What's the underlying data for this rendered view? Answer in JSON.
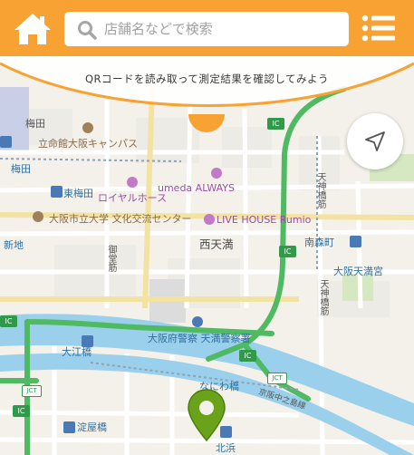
{
  "header": {
    "search": {
      "placeholder": "店舗名などで検索",
      "value": ""
    }
  },
  "banner": {
    "text": "QRコードを読み取って測定結果を確認してみよう"
  },
  "map": {
    "labels": {
      "umeda": "梅田",
      "ritsumeikan": "立命館大阪キャンパス",
      "umeda2": "梅田",
      "higashi_umeda": "東梅田",
      "royal_horse": "ロイヤルホース",
      "umeda_always": "umeda ALWAYS",
      "osaka_city_univ": "大阪市立大学 文化交流センター",
      "live_house": "LIVE HOUSE Rumio",
      "shinchi": "新地",
      "nishi_temma": "西天満",
      "minamimori": "南森町",
      "osaka_temmangu": "大阪天満宮",
      "tenjinbashi": "天神橋筋",
      "tenjinbashi_top": "天神橋筋",
      "police": "大阪府警察 天満警察署",
      "oebashi": "大江橋",
      "naniwabashi": "なにわ橋",
      "keihan": "京阪中之島線",
      "yodoyabashi": "淀屋橋",
      "kitahama": "北浜",
      "midosuji": "御堂筋"
    },
    "badges": {
      "ic": "IC",
      "jct": "JCT"
    }
  },
  "colors": {
    "brand_orange": "#f7a232",
    "pin_green": "#6aa21a",
    "road_green": "#4fba62",
    "river_blue": "#9bd0ec",
    "map_bg": "#f4f1ea"
  }
}
